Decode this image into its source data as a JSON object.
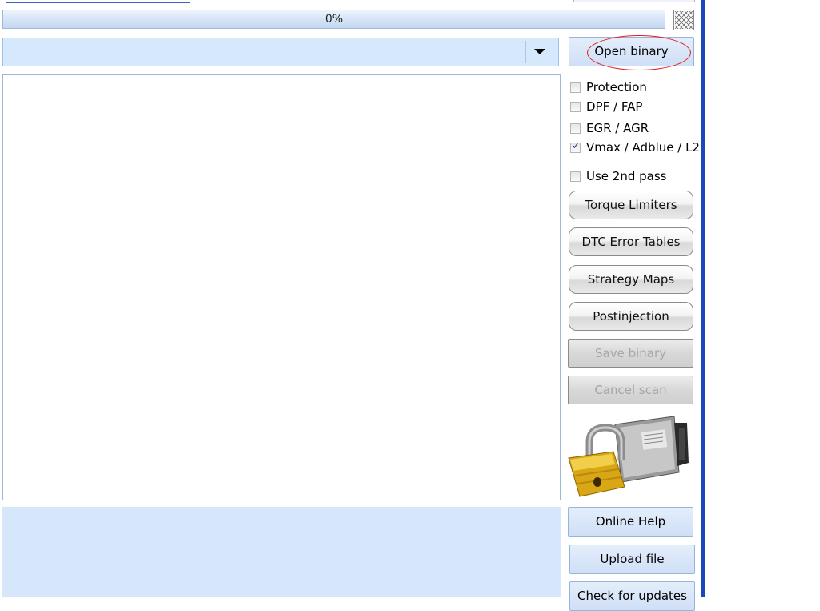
{
  "progress": {
    "value_pct": 0,
    "label": "0%"
  },
  "combo": {
    "selected": ""
  },
  "buttons": {
    "open_binary": "Open binary",
    "torque_limiters": "Torque Limiters",
    "dtc_error_tables": "DTC Error Tables",
    "strategy_maps": "Strategy Maps",
    "postinjection": "Postinjection",
    "save_binary": "Save binary",
    "cancel_scan": "Cancel scan",
    "online_help": "Online Help",
    "upload_file": "Upload file",
    "check_updates": "Check for updates"
  },
  "options": [
    {
      "label": "Protection",
      "checked": false
    },
    {
      "label": "DPF / FAP",
      "checked": false
    },
    {
      "label": "EGR / AGR",
      "checked": false
    },
    {
      "label": "Vmax / Adblue / L2",
      "checked": true
    }
  ],
  "use_2nd_pass": {
    "label": "Use 2nd pass",
    "checked": false
  },
  "colors": {
    "accent": "#1c47b8",
    "panel": "#d7e7fb",
    "highlight_oval": "#e21a1a"
  },
  "icons": {
    "ecu_lock": "padlock-ecu-icon",
    "cancel": "cancel-progress-icon"
  }
}
